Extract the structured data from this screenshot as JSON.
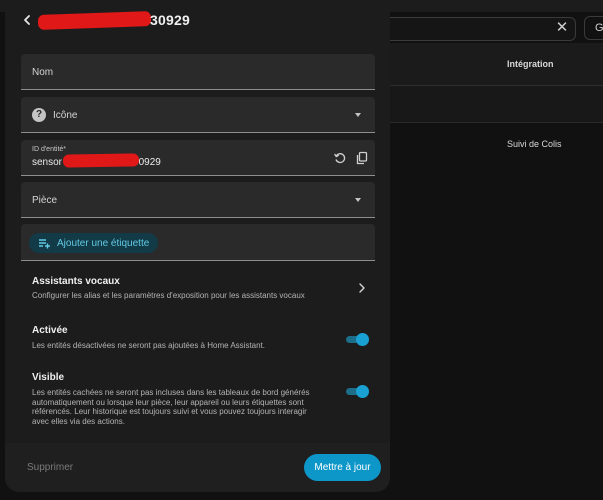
{
  "background": {
    "search_close_icon": "close-icon",
    "chip_label": "Gr",
    "column_integration": "Intégration",
    "cell_integration": "Suivi de Colis"
  },
  "dialog": {
    "back_icon": "chevron-left-icon",
    "title_suffix": "30929",
    "fields": {
      "name_label": "Nom",
      "icon_label": "Icône",
      "entity_id_label": "ID d'entité*",
      "entity_id_prefix": "sensor",
      "entity_id_suffix": "30929",
      "area_label": "Pièce"
    },
    "add_label_button": "Ajouter une étiquette",
    "voice_assistants": {
      "title": "Assistants vocaux",
      "description": "Configurer les alias et les paramètres d'exposition pour les assistants vocaux"
    },
    "enabled": {
      "title": "Activée",
      "description": "Les entités désactivées ne seront pas ajoutées à Home Assistant.",
      "value": true
    },
    "visible": {
      "title": "Visible",
      "description": "Les entités cachées ne seront pas incluses dans les tableaux de bord générés automatiquement ou lorsque leur pièce, leur appareil ou leurs étiquettes sont référencés. Leur historique est toujours suivi et vous pouvez toujours interagir avec elles via des actions.",
      "value": true
    },
    "footer": {
      "delete_label": "Supprimer",
      "update_label": "Mettre à jour"
    }
  },
  "colors": {
    "accent": "#0d97c9",
    "tag_text": "#62cae4",
    "redaction": "#e01818"
  }
}
